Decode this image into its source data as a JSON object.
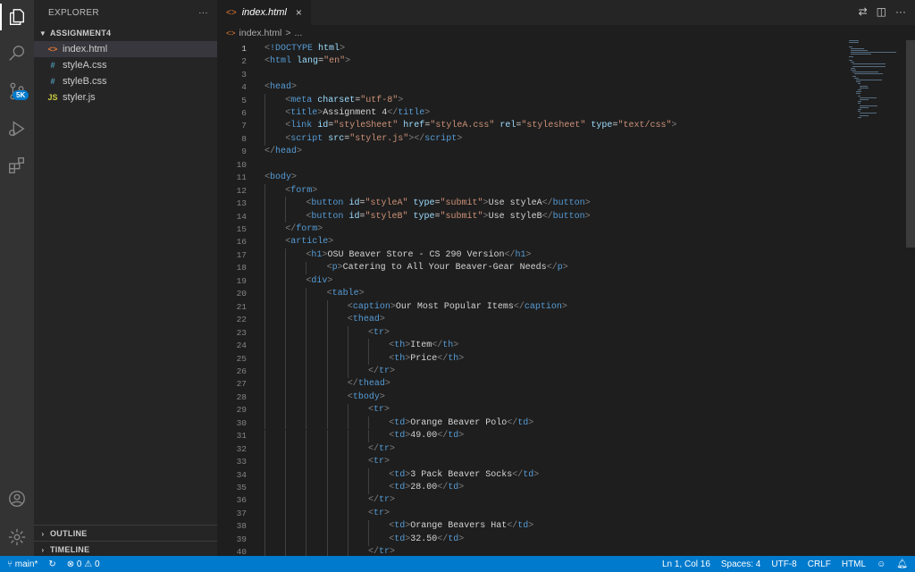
{
  "sidebar": {
    "title": "EXPLORER",
    "more": "···",
    "folder": "ASSIGNMENT4",
    "files": [
      {
        "name": "index.html",
        "icon": "<>",
        "icon_color": "#e37933",
        "selected": true
      },
      {
        "name": "styleA.css",
        "icon": "#",
        "icon_color": "#519aba"
      },
      {
        "name": "styleB.css",
        "icon": "#",
        "icon_color": "#519aba"
      },
      {
        "name": "styler.js",
        "icon": "JS",
        "icon_color": "#cbcb41"
      }
    ],
    "outline": "OUTLINE",
    "timeline": "TIMELINE"
  },
  "activity": {
    "badge": "5K"
  },
  "tabs": [
    {
      "label": "index.html",
      "icon": "<>",
      "close": "×"
    }
  ],
  "breadcrumb": {
    "file": "index.html",
    "sep": ">",
    "rest": "..."
  },
  "status": {
    "branch": "main*",
    "problems": "⊗ 0 ⚠ 0",
    "position": "Ln 1, Col 16",
    "spaces": "Spaces: 4",
    "encoding": "UTF-8",
    "eol": "CRLF",
    "language": "HTML"
  },
  "code_lines": [
    {
      "n": 1,
      "ind": 0,
      "parts": [
        [
          "t",
          "<"
        ],
        [
          "tag",
          "!DOCTYPE"
        ],
        [
          "txt",
          " "
        ],
        [
          "attr",
          "html"
        ],
        [
          "t",
          ">"
        ]
      ]
    },
    {
      "n": 2,
      "ind": 0,
      "parts": [
        [
          "t",
          "<"
        ],
        [
          "tag",
          "html"
        ],
        [
          "txt",
          " "
        ],
        [
          "attr",
          "lang"
        ],
        [
          "txt",
          "="
        ],
        [
          "str",
          "\"en\""
        ],
        [
          "t",
          ">"
        ]
      ]
    },
    {
      "n": 3,
      "ind": 0,
      "parts": []
    },
    {
      "n": 4,
      "ind": 0,
      "parts": [
        [
          "t",
          "<"
        ],
        [
          "tag",
          "head"
        ],
        [
          "t",
          ">"
        ]
      ]
    },
    {
      "n": 5,
      "ind": 1,
      "parts": [
        [
          "t",
          "<"
        ],
        [
          "tag",
          "meta"
        ],
        [
          "txt",
          " "
        ],
        [
          "attr",
          "charset"
        ],
        [
          "txt",
          "="
        ],
        [
          "str",
          "\"utf-8\""
        ],
        [
          "t",
          ">"
        ]
      ]
    },
    {
      "n": 6,
      "ind": 1,
      "parts": [
        [
          "t",
          "<"
        ],
        [
          "tag",
          "title"
        ],
        [
          "t",
          ">"
        ],
        [
          "txt",
          "Assignment 4"
        ],
        [
          "t",
          "</"
        ],
        [
          "tag",
          "title"
        ],
        [
          "t",
          ">"
        ]
      ]
    },
    {
      "n": 7,
      "ind": 1,
      "parts": [
        [
          "t",
          "<"
        ],
        [
          "tag",
          "link"
        ],
        [
          "txt",
          " "
        ],
        [
          "attr",
          "id"
        ],
        [
          "txt",
          "="
        ],
        [
          "str",
          "\"styleSheet\""
        ],
        [
          "txt",
          " "
        ],
        [
          "attr",
          "href"
        ],
        [
          "txt",
          "="
        ],
        [
          "str",
          "\"styleA.css\""
        ],
        [
          "txt",
          " "
        ],
        [
          "attr",
          "rel"
        ],
        [
          "txt",
          "="
        ],
        [
          "str",
          "\"stylesheet\""
        ],
        [
          "txt",
          " "
        ],
        [
          "attr",
          "type"
        ],
        [
          "txt",
          "="
        ],
        [
          "str",
          "\"text/css\""
        ],
        [
          "t",
          ">"
        ]
      ]
    },
    {
      "n": 8,
      "ind": 1,
      "parts": [
        [
          "t",
          "<"
        ],
        [
          "tag",
          "script"
        ],
        [
          "txt",
          " "
        ],
        [
          "attr",
          "src"
        ],
        [
          "txt",
          "="
        ],
        [
          "str",
          "\"styler.js\""
        ],
        [
          "t",
          "></"
        ],
        [
          "tag",
          "script"
        ],
        [
          "t",
          ">"
        ]
      ]
    },
    {
      "n": 9,
      "ind": 0,
      "parts": [
        [
          "t",
          "</"
        ],
        [
          "tag",
          "head"
        ],
        [
          "t",
          ">"
        ]
      ]
    },
    {
      "n": 10,
      "ind": 0,
      "parts": []
    },
    {
      "n": 11,
      "ind": 0,
      "parts": [
        [
          "t",
          "<"
        ],
        [
          "tag",
          "body"
        ],
        [
          "t",
          ">"
        ]
      ]
    },
    {
      "n": 12,
      "ind": 1,
      "parts": [
        [
          "t",
          "<"
        ],
        [
          "tag",
          "form"
        ],
        [
          "t",
          ">"
        ]
      ]
    },
    {
      "n": 13,
      "ind": 2,
      "parts": [
        [
          "t",
          "<"
        ],
        [
          "tag",
          "button"
        ],
        [
          "txt",
          " "
        ],
        [
          "attr",
          "id"
        ],
        [
          "txt",
          "="
        ],
        [
          "str",
          "\"styleA\""
        ],
        [
          "txt",
          " "
        ],
        [
          "attr",
          "type"
        ],
        [
          "txt",
          "="
        ],
        [
          "str",
          "\"submit\""
        ],
        [
          "t",
          ">"
        ],
        [
          "txt",
          "Use styleA"
        ],
        [
          "t",
          "</"
        ],
        [
          "tag",
          "button"
        ],
        [
          "t",
          ">"
        ]
      ]
    },
    {
      "n": 14,
      "ind": 2,
      "parts": [
        [
          "t",
          "<"
        ],
        [
          "tag",
          "button"
        ],
        [
          "txt",
          " "
        ],
        [
          "attr",
          "id"
        ],
        [
          "txt",
          "="
        ],
        [
          "str",
          "\"styleB\""
        ],
        [
          "txt",
          " "
        ],
        [
          "attr",
          "type"
        ],
        [
          "txt",
          "="
        ],
        [
          "str",
          "\"submit\""
        ],
        [
          "t",
          ">"
        ],
        [
          "txt",
          "Use styleB"
        ],
        [
          "t",
          "</"
        ],
        [
          "tag",
          "button"
        ],
        [
          "t",
          ">"
        ]
      ]
    },
    {
      "n": 15,
      "ind": 1,
      "parts": [
        [
          "t",
          "</"
        ],
        [
          "tag",
          "form"
        ],
        [
          "t",
          ">"
        ]
      ]
    },
    {
      "n": 16,
      "ind": 1,
      "parts": [
        [
          "t",
          "<"
        ],
        [
          "tag",
          "article"
        ],
        [
          "t",
          ">"
        ]
      ]
    },
    {
      "n": 17,
      "ind": 2,
      "parts": [
        [
          "t",
          "<"
        ],
        [
          "tag",
          "h1"
        ],
        [
          "t",
          ">"
        ],
        [
          "txt",
          "OSU Beaver Store - CS 290 Version"
        ],
        [
          "t",
          "</"
        ],
        [
          "tag",
          "h1"
        ],
        [
          "t",
          ">"
        ]
      ]
    },
    {
      "n": 18,
      "ind": 3,
      "parts": [
        [
          "t",
          "<"
        ],
        [
          "tag",
          "p"
        ],
        [
          "t",
          ">"
        ],
        [
          "txt",
          "Catering to All Your Beaver-Gear Needs"
        ],
        [
          "t",
          "</"
        ],
        [
          "tag",
          "p"
        ],
        [
          "t",
          ">"
        ]
      ]
    },
    {
      "n": 19,
      "ind": 2,
      "parts": [
        [
          "t",
          "<"
        ],
        [
          "tag",
          "div"
        ],
        [
          "t",
          ">"
        ]
      ]
    },
    {
      "n": 20,
      "ind": 3,
      "parts": [
        [
          "t",
          "<"
        ],
        [
          "tag",
          "table"
        ],
        [
          "t",
          ">"
        ]
      ]
    },
    {
      "n": 21,
      "ind": 4,
      "parts": [
        [
          "t",
          "<"
        ],
        [
          "tag",
          "caption"
        ],
        [
          "t",
          ">"
        ],
        [
          "txt",
          "Our Most Popular Items"
        ],
        [
          "t",
          "</"
        ],
        [
          "tag",
          "caption"
        ],
        [
          "t",
          ">"
        ]
      ]
    },
    {
      "n": 22,
      "ind": 4,
      "parts": [
        [
          "t",
          "<"
        ],
        [
          "tag",
          "thead"
        ],
        [
          "t",
          ">"
        ]
      ]
    },
    {
      "n": 23,
      "ind": 5,
      "parts": [
        [
          "t",
          "<"
        ],
        [
          "tag",
          "tr"
        ],
        [
          "t",
          ">"
        ]
      ]
    },
    {
      "n": 24,
      "ind": 6,
      "parts": [
        [
          "t",
          "<"
        ],
        [
          "tag",
          "th"
        ],
        [
          "t",
          ">"
        ],
        [
          "txt",
          "Item"
        ],
        [
          "t",
          "</"
        ],
        [
          "tag",
          "th"
        ],
        [
          "t",
          ">"
        ]
      ]
    },
    {
      "n": 25,
      "ind": 6,
      "parts": [
        [
          "t",
          "<"
        ],
        [
          "tag",
          "th"
        ],
        [
          "t",
          ">"
        ],
        [
          "txt",
          "Price"
        ],
        [
          "t",
          "</"
        ],
        [
          "tag",
          "th"
        ],
        [
          "t",
          ">"
        ]
      ]
    },
    {
      "n": 26,
      "ind": 5,
      "parts": [
        [
          "t",
          "</"
        ],
        [
          "tag",
          "tr"
        ],
        [
          "t",
          ">"
        ]
      ]
    },
    {
      "n": 27,
      "ind": 4,
      "parts": [
        [
          "t",
          "</"
        ],
        [
          "tag",
          "thead"
        ],
        [
          "t",
          ">"
        ]
      ]
    },
    {
      "n": 28,
      "ind": 4,
      "parts": [
        [
          "t",
          "<"
        ],
        [
          "tag",
          "tbody"
        ],
        [
          "t",
          ">"
        ]
      ]
    },
    {
      "n": 29,
      "ind": 5,
      "parts": [
        [
          "t",
          "<"
        ],
        [
          "tag",
          "tr"
        ],
        [
          "t",
          ">"
        ]
      ]
    },
    {
      "n": 30,
      "ind": 6,
      "parts": [
        [
          "t",
          "<"
        ],
        [
          "tag",
          "td"
        ],
        [
          "t",
          ">"
        ],
        [
          "txt",
          "Orange Beaver Polo"
        ],
        [
          "t",
          "</"
        ],
        [
          "tag",
          "td"
        ],
        [
          "t",
          ">"
        ]
      ]
    },
    {
      "n": 31,
      "ind": 6,
      "parts": [
        [
          "t",
          "<"
        ],
        [
          "tag",
          "td"
        ],
        [
          "t",
          ">"
        ],
        [
          "txt",
          "49.00"
        ],
        [
          "t",
          "</"
        ],
        [
          "tag",
          "td"
        ],
        [
          "t",
          ">"
        ]
      ]
    },
    {
      "n": 32,
      "ind": 5,
      "parts": [
        [
          "t",
          "</"
        ],
        [
          "tag",
          "tr"
        ],
        [
          "t",
          ">"
        ]
      ]
    },
    {
      "n": 33,
      "ind": 5,
      "parts": [
        [
          "t",
          "<"
        ],
        [
          "tag",
          "tr"
        ],
        [
          "t",
          ">"
        ]
      ]
    },
    {
      "n": 34,
      "ind": 6,
      "parts": [
        [
          "t",
          "<"
        ],
        [
          "tag",
          "td"
        ],
        [
          "t",
          ">"
        ],
        [
          "txt",
          "3 Pack Beaver Socks"
        ],
        [
          "t",
          "</"
        ],
        [
          "tag",
          "td"
        ],
        [
          "t",
          ">"
        ]
      ]
    },
    {
      "n": 35,
      "ind": 6,
      "parts": [
        [
          "t",
          "<"
        ],
        [
          "tag",
          "td"
        ],
        [
          "t",
          ">"
        ],
        [
          "txt",
          "28.00"
        ],
        [
          "t",
          "</"
        ],
        [
          "tag",
          "td"
        ],
        [
          "t",
          ">"
        ]
      ]
    },
    {
      "n": 36,
      "ind": 5,
      "parts": [
        [
          "t",
          "</"
        ],
        [
          "tag",
          "tr"
        ],
        [
          "t",
          ">"
        ]
      ]
    },
    {
      "n": 37,
      "ind": 5,
      "parts": [
        [
          "t",
          "<"
        ],
        [
          "tag",
          "tr"
        ],
        [
          "t",
          ">"
        ]
      ]
    },
    {
      "n": 38,
      "ind": 6,
      "parts": [
        [
          "t",
          "<"
        ],
        [
          "tag",
          "td"
        ],
        [
          "t",
          ">"
        ],
        [
          "txt",
          "Orange Beavers Hat"
        ],
        [
          "t",
          "</"
        ],
        [
          "tag",
          "td"
        ],
        [
          "t",
          ">"
        ]
      ]
    },
    {
      "n": 39,
      "ind": 6,
      "parts": [
        [
          "t",
          "<"
        ],
        [
          "tag",
          "td"
        ],
        [
          "t",
          ">"
        ],
        [
          "txt",
          "32.50"
        ],
        [
          "t",
          "</"
        ],
        [
          "tag",
          "td"
        ],
        [
          "t",
          ">"
        ]
      ]
    },
    {
      "n": 40,
      "ind": 5,
      "parts": [
        [
          "t",
          "</"
        ],
        [
          "tag",
          "tr"
        ],
        [
          "t",
          ">"
        ]
      ]
    }
  ]
}
